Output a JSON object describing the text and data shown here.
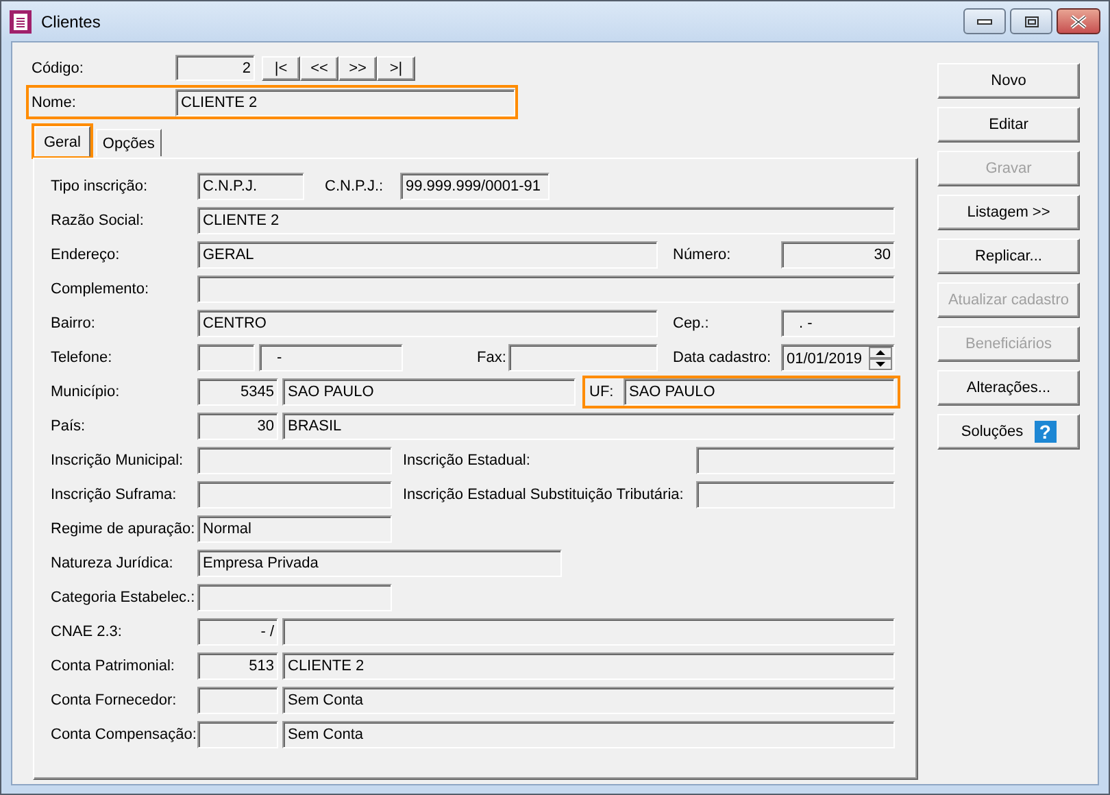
{
  "window": {
    "title": "Clientes"
  },
  "codigo": {
    "label": "Código:",
    "value": "2"
  },
  "nav_buttons": [
    "|<",
    "<<",
    ">>",
    ">|"
  ],
  "nome": {
    "label": "Nome:",
    "value": "CLIENTE 2",
    "highlighted": true
  },
  "tabs": [
    {
      "label": "Geral",
      "selected": true,
      "highlighted": true
    },
    {
      "label": "Opções",
      "selected": false,
      "highlighted": false
    }
  ],
  "form": {
    "rows": [
      {
        "items": [
          {
            "kind": "label",
            "text": "Tipo inscrição:"
          },
          {
            "kind": "field",
            "value": "C.N.P.J."
          },
          {
            "kind": "label",
            "text": "C.N.P.J.:"
          },
          {
            "kind": "field",
            "value": "99.999.999/0001-91"
          }
        ]
      },
      {
        "items": [
          {
            "kind": "label",
            "text": "Razão Social:"
          },
          {
            "kind": "field",
            "value": "CLIENTE 2"
          }
        ]
      },
      {
        "items": [
          {
            "kind": "label",
            "text": "Endereço:"
          },
          {
            "kind": "field",
            "value": "GERAL"
          },
          {
            "kind": "label",
            "text": "Número:"
          },
          {
            "kind": "field",
            "value": "30"
          }
        ]
      },
      {
        "items": [
          {
            "kind": "label",
            "text": "Complemento:"
          },
          {
            "kind": "field"
          }
        ]
      },
      {
        "items": [
          {
            "kind": "label",
            "text": "Bairro:"
          },
          {
            "kind": "field",
            "value": "CENTRO"
          },
          {
            "kind": "label",
            "text": "Cep.:"
          },
          {
            "kind": "field",
            "value": ".  -"
          }
        ]
      },
      {
        "items": [
          {
            "kind": "label",
            "text": "Telefone:"
          },
          {
            "kind": "field"
          },
          {
            "kind": "field",
            "value": "-"
          },
          {
            "kind": "label",
            "text": "Fax:"
          },
          {
            "kind": "field"
          },
          {
            "kind": "label",
            "text": "Data cadastro:"
          },
          {
            "kind": "date",
            "value": "01/01/2019"
          }
        ]
      },
      {
        "items": [
          {
            "kind": "label",
            "text": "Município:"
          },
          {
            "kind": "field",
            "value": "5345"
          },
          {
            "kind": "field",
            "value": "SAO PAULO"
          },
          {
            "kind": "group",
            "highlighted": true,
            "items": [
              {
                "kind": "label",
                "text": "UF:"
              },
              {
                "kind": "field",
                "value": "SAO PAULO"
              }
            ]
          }
        ]
      },
      {
        "items": [
          {
            "kind": "label",
            "text": "País:"
          },
          {
            "kind": "field",
            "value": "30"
          },
          {
            "kind": "field",
            "value": "BRASIL"
          }
        ]
      },
      {
        "items": [
          {
            "kind": "label",
            "text": "Inscrição Municipal:"
          },
          {
            "kind": "field"
          },
          {
            "kind": "label",
            "text": "Inscrição Estadual:"
          },
          {
            "kind": "field"
          }
        ]
      },
      {
        "items": [
          {
            "kind": "label",
            "text": "Inscrição Suframa:"
          },
          {
            "kind": "field"
          },
          {
            "kind": "label",
            "text": "Inscrição Estadual Substituição Tributária:"
          },
          {
            "kind": "field"
          }
        ]
      },
      {
        "items": [
          {
            "kind": "label",
            "text": "Regime de apuração:"
          },
          {
            "kind": "field",
            "value": "Normal"
          }
        ]
      },
      {
        "items": [
          {
            "kind": "label",
            "text": "Natureza Jurídica:"
          },
          {
            "kind": "field",
            "value": "Empresa Privada"
          }
        ]
      },
      {
        "items": [
          {
            "kind": "label",
            "text": "Categoria Estabelec.:"
          },
          {
            "kind": "field"
          }
        ]
      },
      {
        "items": [
          {
            "kind": "label",
            "text": "CNAE 2.3:"
          },
          {
            "kind": "field",
            "value": "- /"
          },
          {
            "kind": "field"
          }
        ]
      },
      {
        "items": [
          {
            "kind": "label",
            "text": "Conta Patrimonial:"
          },
          {
            "kind": "field",
            "value": "513"
          },
          {
            "kind": "field",
            "value": "CLIENTE 2"
          }
        ]
      },
      {
        "items": [
          {
            "kind": "label",
            "text": "Conta Fornecedor:"
          },
          {
            "kind": "field"
          },
          {
            "kind": "field",
            "value": "Sem Conta"
          }
        ]
      },
      {
        "items": [
          {
            "kind": "label",
            "text": "Conta Compensação:"
          },
          {
            "kind": "field"
          },
          {
            "kind": "field",
            "value": "Sem Conta"
          }
        ]
      }
    ]
  },
  "buttons": [
    {
      "label": "Novo",
      "disabled": false
    },
    {
      "label": "Editar",
      "disabled": false
    },
    {
      "label": "Gravar",
      "disabled": true
    },
    {
      "label": "Listagem >>",
      "disabled": false
    },
    {
      "label": "Replicar...",
      "disabled": false
    },
    {
      "label": "Atualizar cadastro",
      "disabled": true
    },
    {
      "label": "Beneficiários",
      "disabled": true
    },
    {
      "label": "Alterações...",
      "disabled": false
    },
    {
      "label": "Soluções",
      "disabled": false,
      "icon": "?"
    }
  ]
}
